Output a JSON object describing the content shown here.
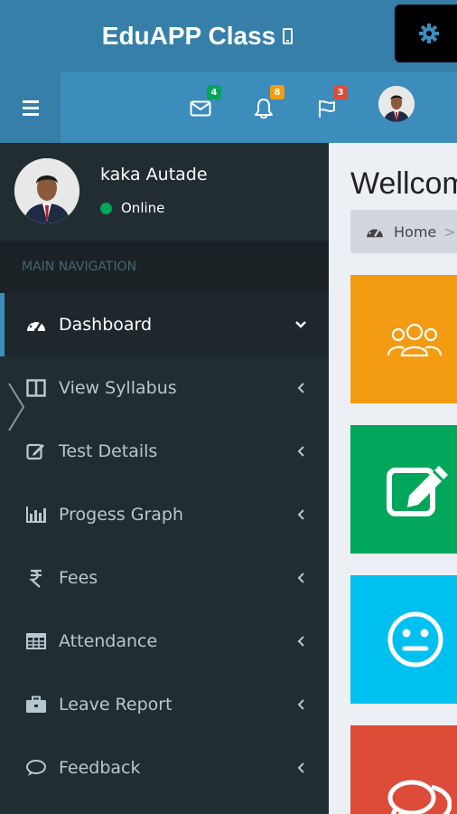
{
  "app": {
    "title": "EduAPP Class"
  },
  "navbar": {
    "messages_badge": "4",
    "notifications_badge": "8",
    "tasks_badge": "3",
    "colors": {
      "messages": "#00a65a",
      "notifications": "#f39c12",
      "tasks": "#dd4b39"
    }
  },
  "user": {
    "name": "kaka Autade",
    "status": "Online"
  },
  "sidebar": {
    "header": "MAIN NAVIGATION",
    "items": [
      {
        "label": "Dashboard",
        "icon": "dashboard-icon"
      },
      {
        "label": "View Syllabus",
        "icon": "columns-icon"
      },
      {
        "label": "Test Details",
        "icon": "edit-icon"
      },
      {
        "label": "Progess Graph",
        "icon": "bar-chart-icon"
      },
      {
        "label": "Fees",
        "icon": "rupee-icon"
      },
      {
        "label": "Attendance",
        "icon": "table-icon"
      },
      {
        "label": "Leave Report",
        "icon": "briefcase-icon"
      },
      {
        "label": "Feedback",
        "icon": "comment-icon"
      }
    ]
  },
  "content": {
    "title": "Wellcome",
    "breadcrumb": {
      "home": "Home",
      "separator": ">"
    },
    "tiles": [
      {
        "icon": "users-icon",
        "color": "#f39c12"
      },
      {
        "icon": "edit-icon",
        "color": "#00a65a"
      },
      {
        "icon": "meh-face-icon",
        "color": "#00c0ef"
      },
      {
        "icon": "comments-icon",
        "color": "#dd4b39"
      }
    ]
  }
}
